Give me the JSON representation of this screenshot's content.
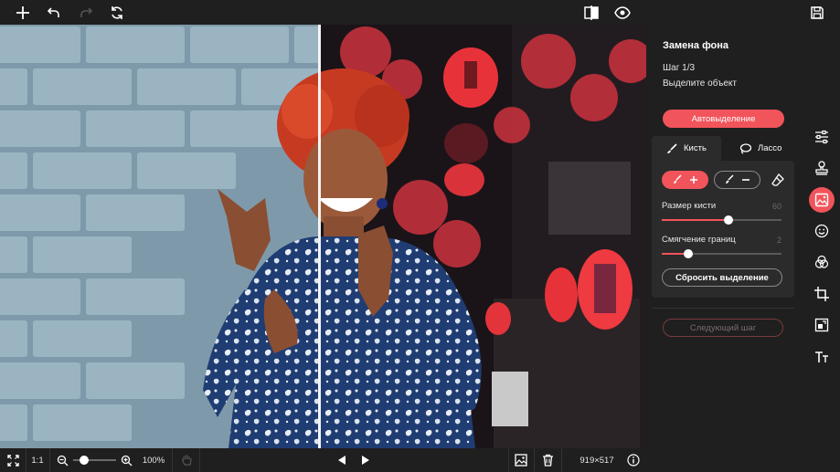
{
  "toolbar": {
    "icons": [
      "add-icon",
      "undo-icon",
      "redo-icon",
      "reset-icon",
      "compare-icon",
      "preview-icon",
      "save-icon"
    ]
  },
  "panel": {
    "title": "Замена фона",
    "step": "Шаг 1/3",
    "description": "Выделите объект",
    "auto_select_label": "Автовыделение",
    "tabs": [
      {
        "label": "Кисть",
        "icon": "brush-icon",
        "active": true
      },
      {
        "label": "Лассо",
        "icon": "lasso-icon",
        "active": false
      }
    ],
    "brush_size": {
      "label": "Размер кисти",
      "value": "60",
      "fraction": 0.56
    },
    "feather": {
      "label": "Смягчение границ",
      "value": "2",
      "fraction": 0.22
    },
    "reset_selection_label": "Сбросить выделение",
    "next_step_label": "Следующий шаг"
  },
  "rail": {
    "icons": [
      "adjust-icon",
      "stamp-icon",
      "background-replace-icon",
      "face-icon",
      "color-filters-icon",
      "crop-icon",
      "resize-icon",
      "text-icon"
    ],
    "active_index": 2
  },
  "bottombar": {
    "ratio_label": "1:1",
    "zoom_label": "100%",
    "zoom_fraction": 0.1,
    "size_label": "919×517"
  },
  "colors": {
    "accent": "#f2545b",
    "background": "#1f1f1f",
    "panel_box": "#2b2b2b"
  }
}
